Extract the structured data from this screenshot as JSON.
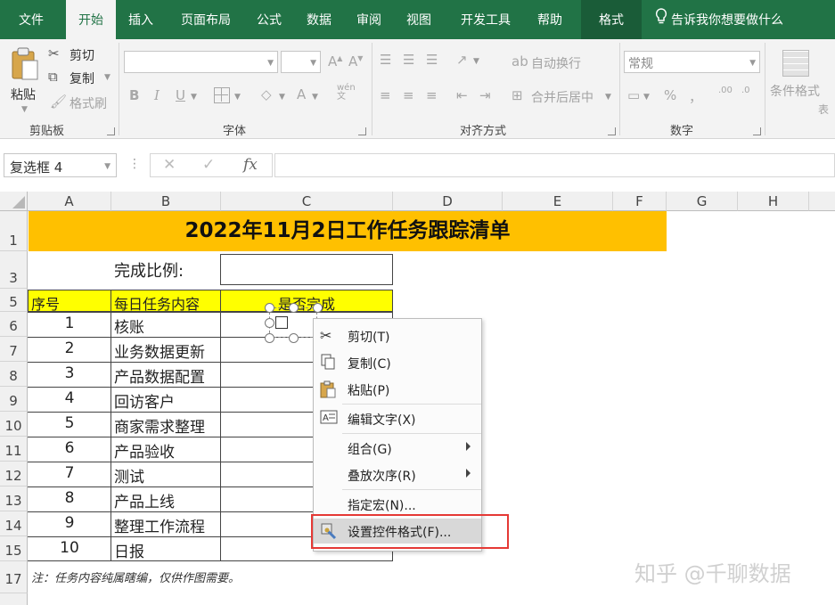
{
  "ribbon_tabs": [
    "文件",
    "开始",
    "插入",
    "页面布局",
    "公式",
    "数据",
    "审阅",
    "视图",
    "开发工具",
    "帮助",
    "格式"
  ],
  "tell_me": "告诉我你想要做什么",
  "clipboard": {
    "paste": "粘贴",
    "cut": "剪切",
    "copy": "复制",
    "format_painter": "格式刷",
    "group": "剪贴板"
  },
  "font": {
    "bold": "B",
    "italic": "I",
    "underline": "U",
    "group": "字体",
    "font_color": "A",
    "phonetic": "wén"
  },
  "alignment": {
    "wrap": "自动换行",
    "merge": "合并后居中",
    "group": "对齐方式"
  },
  "number": {
    "format": "常规",
    "percent": "%",
    "comma": "，",
    "group": "数字",
    "increase_decimal": ".00",
    "decrease_decimal": ".0"
  },
  "styles": {
    "conditional": "条件格式",
    "table_partial": "表"
  },
  "name_box": "复选框 4",
  "fx_label": "fx",
  "columns": [
    "A",
    "B",
    "C",
    "D",
    "E",
    "F",
    "G",
    "H"
  ],
  "rows": [
    "1",
    "3",
    "5",
    "6",
    "7",
    "8",
    "9",
    "10",
    "11",
    "12",
    "13",
    "14",
    "15",
    "17"
  ],
  "title": "2022年11月2日工作任务跟踪清单",
  "completion_label": "完成比例:",
  "headers": {
    "seq": "序号",
    "task": "每日任务内容",
    "done": "是否完成"
  },
  "tasks": [
    {
      "n": "1",
      "t": "核账"
    },
    {
      "n": "2",
      "t": "业务数据更新"
    },
    {
      "n": "3",
      "t": "产品数据配置"
    },
    {
      "n": "4",
      "t": "回访客户"
    },
    {
      "n": "5",
      "t": "商家需求整理"
    },
    {
      "n": "6",
      "t": "产品验收"
    },
    {
      "n": "7",
      "t": "测试"
    },
    {
      "n": "8",
      "t": "产品上线"
    },
    {
      "n": "9",
      "t": "整理工作流程"
    },
    {
      "n": "10",
      "t": "日报"
    }
  ],
  "note": "注：任务内容纯属瞎编，仅供作图需要。",
  "context_menu": [
    "剪切(T)",
    "复制(C)",
    "粘贴(P)",
    "编辑文字(X)",
    "组合(G)",
    "叠放次序(R)",
    "指定宏(N)...",
    "设置控件格式(F)..."
  ],
  "watermark": "知乎 @千聊数据",
  "colors": {
    "excel_green": "#217346",
    "title_fill": "#FFC000",
    "header_fill": "#FFFF00",
    "highlight_border": "#E53935"
  }
}
